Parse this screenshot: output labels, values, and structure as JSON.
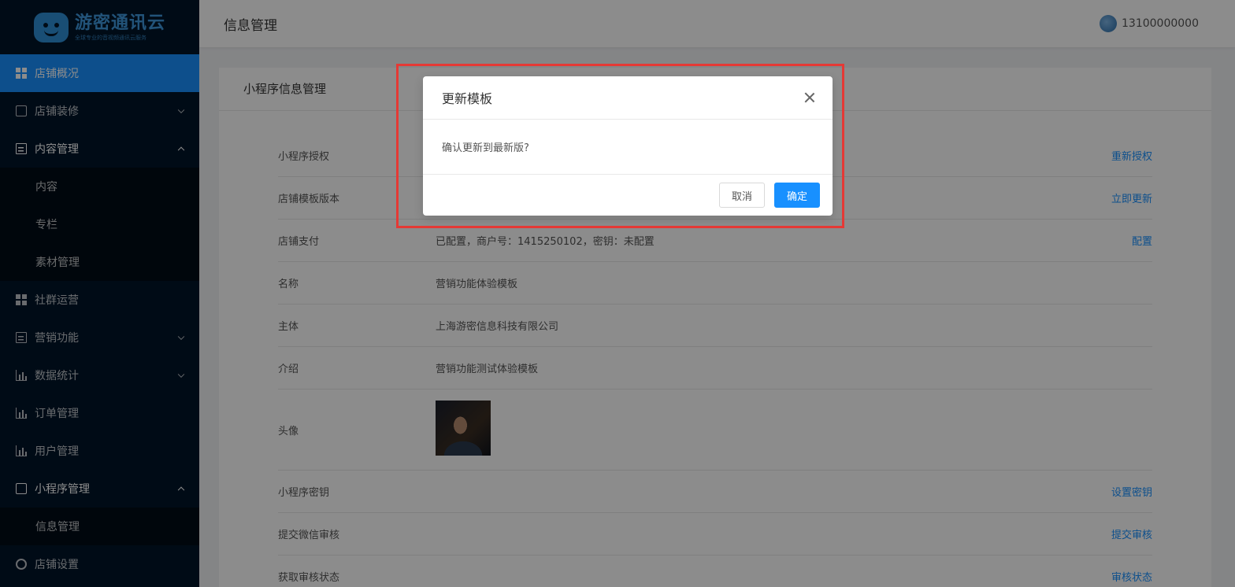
{
  "app": {
    "logo_title": "游密通讯云",
    "logo_subtitle": "全球专业的音视频通讯云服务"
  },
  "sidebar": {
    "items": [
      {
        "label": "店铺概况",
        "icon": "dashboard-grid-icon",
        "state": "active"
      },
      {
        "label": "店铺装修",
        "icon": "shop-icon",
        "state": "collapsed"
      },
      {
        "label": "内容管理",
        "icon": "document-icon",
        "state": "expanded",
        "children": [
          {
            "label": "内容"
          },
          {
            "label": "专栏"
          },
          {
            "label": "素材管理"
          }
        ]
      },
      {
        "label": "社群运营",
        "icon": "dashboard-grid-icon"
      },
      {
        "label": "营销功能",
        "icon": "document-icon",
        "state": "collapsed"
      },
      {
        "label": "数据统计",
        "icon": "bar-chart-icon",
        "state": "collapsed"
      },
      {
        "label": "订单管理",
        "icon": "bar-chart-icon"
      },
      {
        "label": "用户管理",
        "icon": "bar-chart-icon"
      },
      {
        "label": "小程序管理",
        "icon": "shop-icon",
        "state": "expanded",
        "children": [
          {
            "label": "信息管理"
          }
        ]
      },
      {
        "label": "店铺设置",
        "icon": "gear-icon"
      }
    ]
  },
  "header": {
    "title": "信息管理",
    "user": "13100000000"
  },
  "card": {
    "title": "小程序信息管理",
    "rows": [
      {
        "label": "小程序授权",
        "value": "",
        "action": "重新授权"
      },
      {
        "label": "店铺模板版本",
        "value": "",
        "action": "立即更新"
      },
      {
        "label": "店铺支付",
        "value": "已配置，商户号：1415250102，密钥：未配置",
        "action": "配置"
      },
      {
        "label": "名称",
        "value": "营销功能体验模板",
        "action": ""
      },
      {
        "label": "主体",
        "value": "上海游密信息科技有限公司",
        "action": ""
      },
      {
        "label": "介绍",
        "value": "营销功能测试体验模板",
        "action": ""
      },
      {
        "label": "头像",
        "value": "",
        "action": ""
      },
      {
        "label": "小程序密钥",
        "value": "",
        "action": "设置密钥"
      },
      {
        "label": "提交微信审核",
        "value": "",
        "action": "提交审核"
      },
      {
        "label": "获取审核状态",
        "value": "",
        "action": "审核状态"
      }
    ]
  },
  "modal": {
    "title": "更新模板",
    "message": "确认更新到最新版?",
    "cancel_label": "取消",
    "ok_label": "确定"
  },
  "colors": {
    "sidebar_bg": "#001529",
    "accent": "#1890ff",
    "highlight": "#e53935"
  }
}
